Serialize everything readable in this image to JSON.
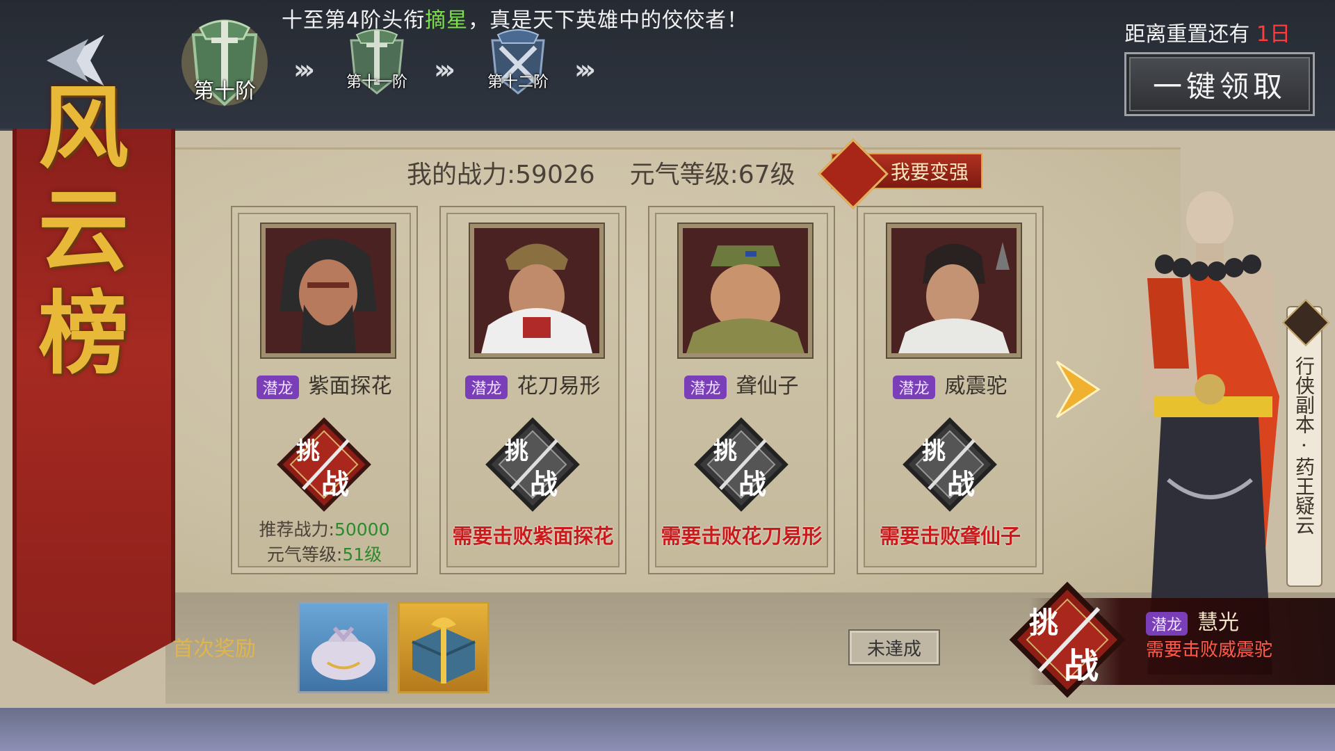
{
  "colors": {
    "accent_red": "#ff3b3b",
    "highlight_green": "#7ee04a",
    "tag_purple": "#7a3fb8",
    "banner_red": "#a52a22"
  },
  "header": {
    "marquee": {
      "prefix": "十至第4阶头衔",
      "highlight": "摘星",
      "suffix": "，真是天下英雄中的佼佼者！"
    },
    "tiers": [
      {
        "label": "第十阶",
        "state": "current",
        "icon": "green-shield-sword-icon"
      },
      {
        "label": "第十一阶",
        "state": "locked",
        "icon": "green-shield-sword-icon"
      },
      {
        "label": "第十二阶",
        "state": "locked",
        "icon": "blue-shield-crossed-swords-icon"
      }
    ],
    "reset": {
      "label": "距离重置还有",
      "days": "1日"
    },
    "claim_all_label": "一键领取"
  },
  "banner_title": "风云榜",
  "stats": {
    "power": "我的战力:59026",
    "level": "元气等级:67级",
    "get_stronger_label": "我要变强"
  },
  "opponents": [
    {
      "tag": "潜龙",
      "name": "紫面探花",
      "status": "available",
      "rec_power_label": "推荐战力:",
      "rec_power": "50000",
      "rec_level_label": "元气等级:",
      "rec_level": "51级"
    },
    {
      "tag": "潜龙",
      "name": "花刀易形",
      "status": "locked",
      "requirement": "需要击败紫面探花"
    },
    {
      "tag": "潜龙",
      "name": "聋仙子",
      "status": "locked",
      "requirement": "需要击败花刀易形"
    },
    {
      "tag": "潜龙",
      "name": "威震驼",
      "status": "locked",
      "requirement": "需要击败聋仙子"
    }
  ],
  "challenge_glyphs": [
    "挑",
    "战"
  ],
  "rewards": {
    "label": "首次奖励",
    "items": [
      {
        "icon": "cloth-bundle-icon"
      },
      {
        "icon": "treasure-chest-icon"
      }
    ],
    "status_label": "未達成"
  },
  "boss": {
    "tag": "潜龙",
    "name": "慧光",
    "requirement": "需要击败威震驼"
  },
  "side_tab": {
    "text": "行侠副本·药王疑云"
  }
}
